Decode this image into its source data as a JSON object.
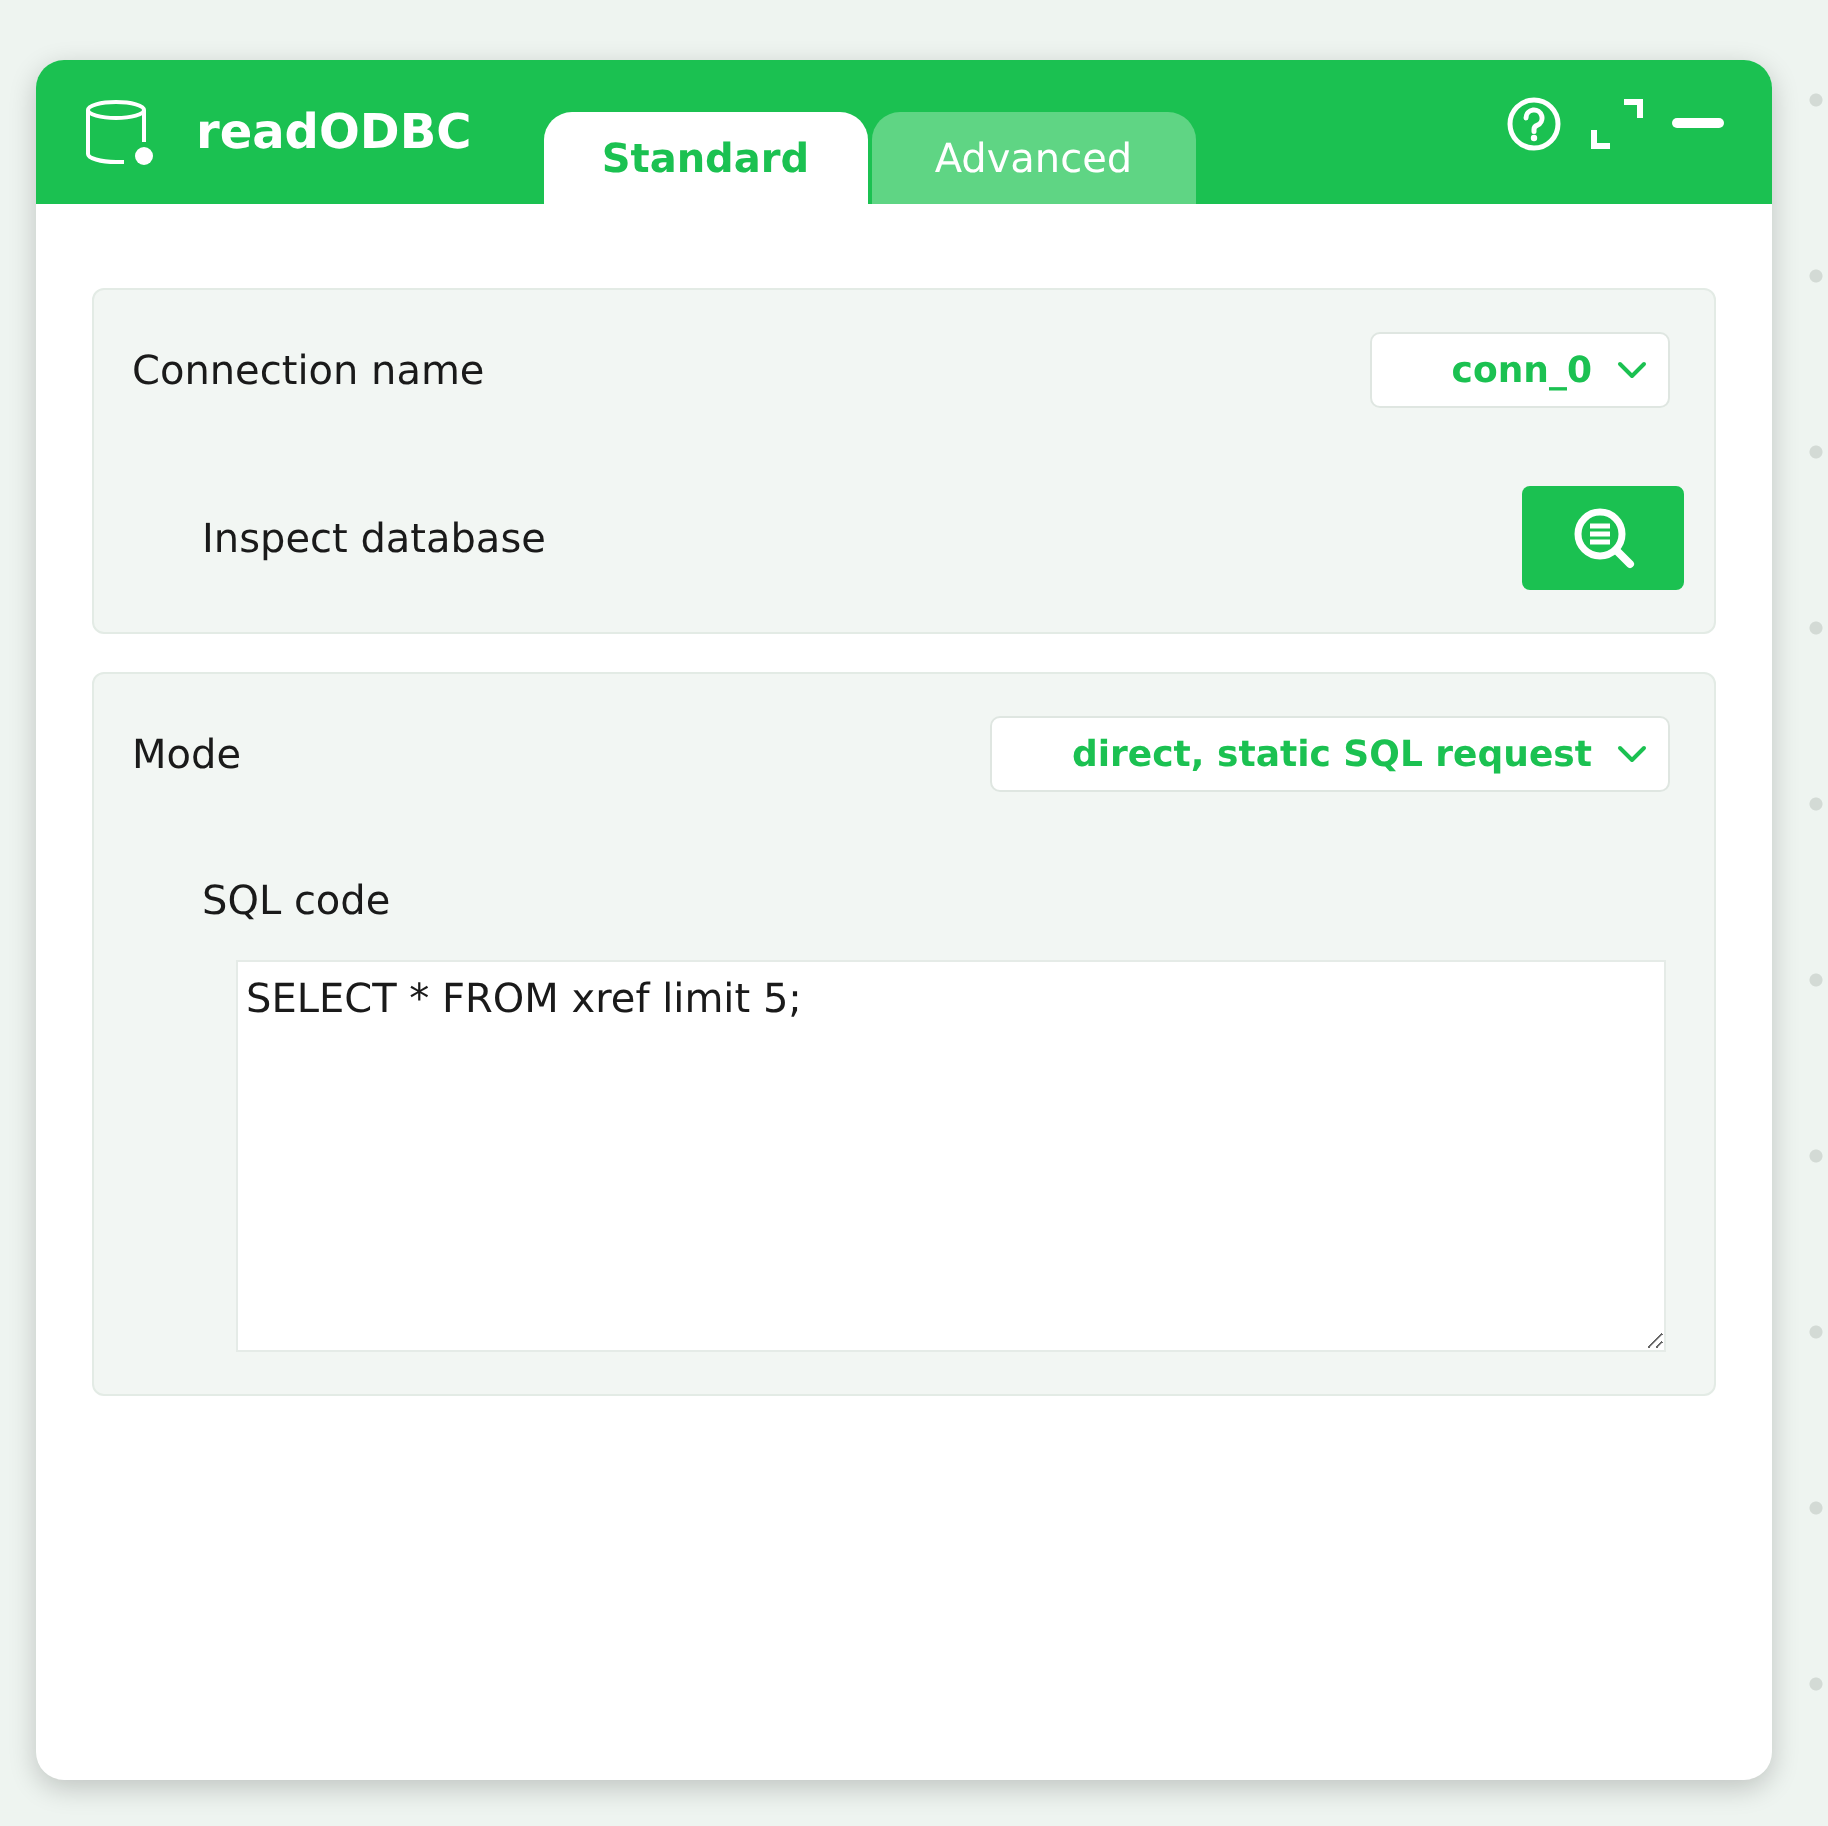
{
  "window": {
    "title": "readODBC"
  },
  "tabs": [
    {
      "label": "Standard",
      "selected": true
    },
    {
      "label": "Advanced",
      "selected": false
    }
  ],
  "sections": [
    {
      "rows": [
        {
          "kind": "select",
          "label": "Connection name",
          "value": "conn_0"
        },
        {
          "kind": "button",
          "label": "Inspect database"
        }
      ]
    },
    {
      "rows": [
        {
          "kind": "select",
          "label": "Mode",
          "value": "direct, static SQL request"
        },
        {
          "kind": "textarea",
          "label": "SQL code",
          "value": "SELECT * FROM xref limit 5;"
        }
      ]
    }
  ]
}
